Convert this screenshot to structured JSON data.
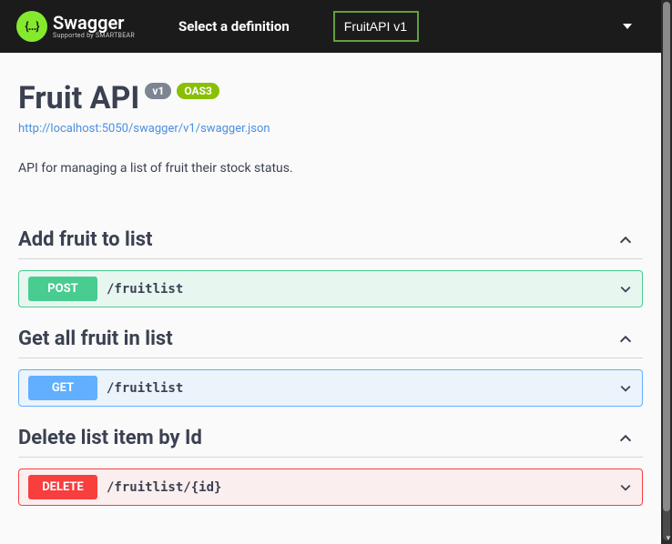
{
  "topbar": {
    "logo_glyph": "{…}",
    "logo_text": "Swagger",
    "logo_sub": "Supported by SMARTBEAR",
    "select_label": "Select a definition",
    "selected_definition": "FruitAPI v1"
  },
  "api": {
    "title": "Fruit API",
    "version": "v1",
    "oas_badge": "OAS3",
    "spec_url": "http://localhost:5050/swagger/v1/swagger.json",
    "description": "API for managing a list of fruit their stock status."
  },
  "sections": [
    {
      "title": "Add fruit to list",
      "op": {
        "method": "POST",
        "path": "/fruitlist"
      }
    },
    {
      "title": "Get all fruit in list",
      "op": {
        "method": "GET",
        "path": "/fruitlist"
      }
    },
    {
      "title": "Delete list item by Id",
      "op": {
        "method": "DELETE",
        "path": "/fruitlist/{id}"
      }
    }
  ]
}
